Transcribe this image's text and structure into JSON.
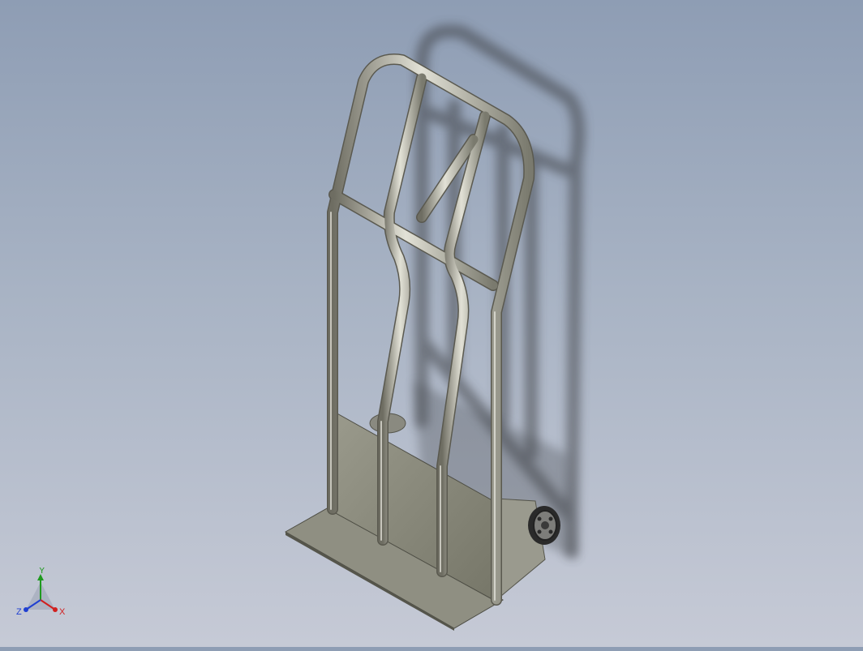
{
  "viewport": {
    "background_top": "#8e9db4",
    "background_bottom": "#c6cad6",
    "model_icon": "hand-truck-model",
    "metal_color": "#b9b8aa",
    "plate_color": "#8a8a7c"
  },
  "triad": {
    "x_label": "X",
    "y_label": "Y",
    "z_label": "Z",
    "x_color": "#d11f1f",
    "y_color": "#1f9a1f",
    "z_color": "#1f3fd1"
  }
}
